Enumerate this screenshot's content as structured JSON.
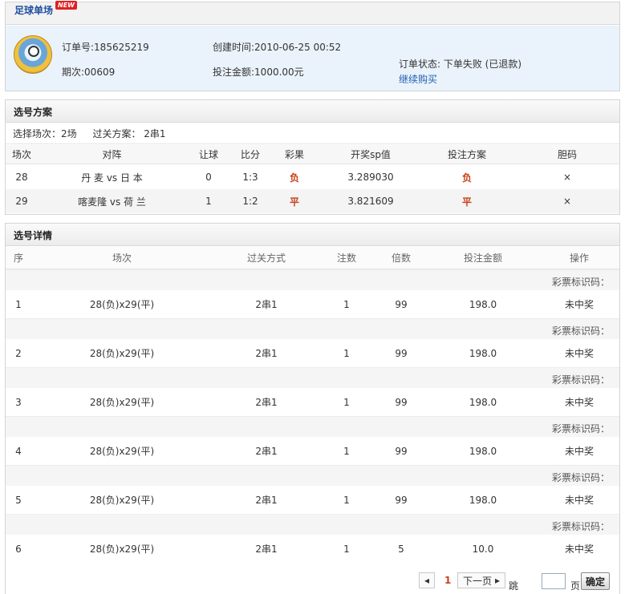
{
  "order": {
    "title": "足球单场",
    "badge": "NEW",
    "order_no": "订单号:185625219",
    "created": "创建时间:2010-06-25 00:52",
    "period": "期次:00609",
    "amount": "投注金额:1000.00元",
    "status": "订单状态: 下单失败 (已退款)",
    "continue_link": "继续购买"
  },
  "plan": {
    "title": "选号方案",
    "matches_label": "选择场次：2场",
    "pass_label": "过关方案： 2串1",
    "columns": [
      "场次",
      "对阵",
      "让球",
      "比分",
      "彩果",
      "开奖sp值",
      "投注方案",
      "胆码"
    ],
    "rows": [
      {
        "no": "28",
        "match": "丹 麦  vs  日 本",
        "handicap": "0",
        "score": "1:3",
        "result": "负",
        "sp": "3.289030",
        "bet": "负",
        "banker": "×"
      },
      {
        "no": "29",
        "match": "喀麦隆  vs  荷 兰",
        "handicap": "1",
        "score": "1:2",
        "result": "平",
        "sp": "3.821609",
        "bet": "平",
        "banker": "×"
      }
    ]
  },
  "details": {
    "title": "选号详情",
    "columns": [
      "序",
      "场次",
      "过关方式",
      "注数",
      "倍数",
      "投注金额",
      "操作"
    ],
    "ticket_label": "彩票标识码：",
    "rows": [
      {
        "idx": "1",
        "matches": "28(负)x29(平)",
        "pass": "2串1",
        "count": "1",
        "multiple": "99",
        "amount": "198.0",
        "action": "未中奖"
      },
      {
        "idx": "2",
        "matches": "28(负)x29(平)",
        "pass": "2串1",
        "count": "1",
        "multiple": "99",
        "amount": "198.0",
        "action": "未中奖"
      },
      {
        "idx": "3",
        "matches": "28(负)x29(平)",
        "pass": "2串1",
        "count": "1",
        "multiple": "99",
        "amount": "198.0",
        "action": "未中奖"
      },
      {
        "idx": "4",
        "matches": "28(负)x29(平)",
        "pass": "2串1",
        "count": "1",
        "multiple": "99",
        "amount": "198.0",
        "action": "未中奖"
      },
      {
        "idx": "5",
        "matches": "28(负)x29(平)",
        "pass": "2串1",
        "count": "1",
        "multiple": "99",
        "amount": "198.0",
        "action": "未中奖"
      },
      {
        "idx": "6",
        "matches": "28(负)x29(平)",
        "pass": "2串1",
        "count": "1",
        "multiple": "5",
        "amount": "10.0",
        "action": "未中奖"
      }
    ]
  },
  "pager": {
    "current": "1",
    "next": "下一页",
    "jump_to": "跳至第",
    "page_unit": "页",
    "confirm": "确定"
  }
}
